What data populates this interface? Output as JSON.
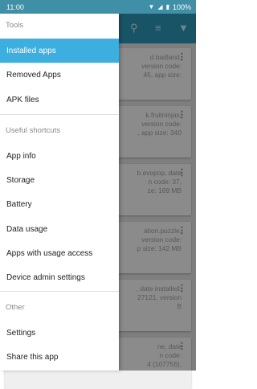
{
  "status_bar": {
    "time": "11:00",
    "battery": "100%",
    "icons": "wifi signal battery"
  },
  "drawer": {
    "sections": [
      {
        "header": "Tools",
        "items": [
          "Installed apps",
          "Removed Apps",
          "APK files"
        ]
      },
      {
        "header": "Useful shortcuts",
        "items": [
          "App info",
          "Storage",
          "Battery",
          "Data usage",
          "Apps with usage access",
          "Device admin settings"
        ]
      },
      {
        "header": "Other",
        "items": [
          "Settings",
          "Share this app"
        ]
      }
    ],
    "active_item": "Installed apps"
  },
  "background_cards": [
    "d.badland,\nversion code:\n45, app size:",
    "k.fruitninjax,\nversion code:\n, app size: 340",
    "b.evopop, date\nn code: 37,\nze: 169 MB",
    "ation.puzzle,\nversion code:\np size: 142 MB",
    ", date installed:\n27121, version\nB",
    "ne, date\nn code:\n4 (107756),"
  ],
  "colors": {
    "accent": "#3daee0",
    "toolbar": "#2b8fb0",
    "status_bar": "#3f8fa6"
  }
}
